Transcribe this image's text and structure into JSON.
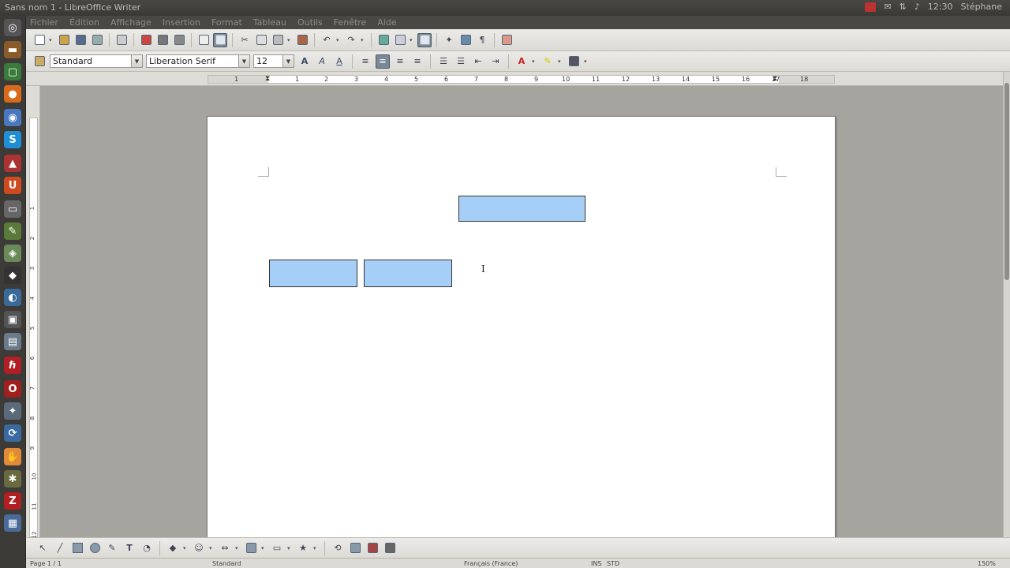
{
  "window": {
    "title": "Sans nom 1 - LibreOffice Writer"
  },
  "topbar": {
    "clock": "12:30",
    "user": "Stéphane"
  },
  "menubar": {
    "items": [
      "Fichier",
      "Édition",
      "Affichage",
      "Insertion",
      "Format",
      "Tableau",
      "Outils",
      "Fenêtre",
      "Aide"
    ]
  },
  "formatting": {
    "paragraph_style": "Standard",
    "font_name": "Liberation Serif",
    "font_size": "12"
  },
  "ruler": {
    "ticks": [
      "1",
      "1",
      "2",
      "3",
      "4",
      "5",
      "6",
      "7",
      "8",
      "9",
      "10",
      "11",
      "12",
      "13",
      "14",
      "15",
      "16",
      "17",
      "18"
    ]
  },
  "vruler": {
    "ticks": [
      "1",
      "2",
      "3",
      "4",
      "5",
      "6",
      "7",
      "8",
      "9",
      "10",
      "11",
      "12"
    ]
  },
  "launcher": {
    "icons": [
      "home-icon",
      "files-icon",
      "terminal-icon",
      "firefox-icon",
      "chromium-icon",
      "skype-icon",
      "bag-icon",
      "ubuntu-one-icon",
      "screen-icon",
      "pencil-icon",
      "gimp-icon",
      "inkscape-icon",
      "blender-icon",
      "monitor-icon",
      "image-icon",
      "app-icon",
      "opera-icon",
      "tools-icon",
      "sync-icon",
      "foot-icon",
      "bug-icon",
      "filezilla-icon",
      "files2-icon"
    ]
  },
  "statusbar": {
    "page": "Page 1 / 1",
    "style": "Standard",
    "language": "Français (France)",
    "mode": "INS",
    "selection": "STD",
    "zoom": "150%"
  },
  "colors": {
    "shape_fill": "#a6cff7",
    "shape_border": "#333333",
    "page_bg": "#ffffff",
    "workspace_bg": "#a5a49f"
  }
}
